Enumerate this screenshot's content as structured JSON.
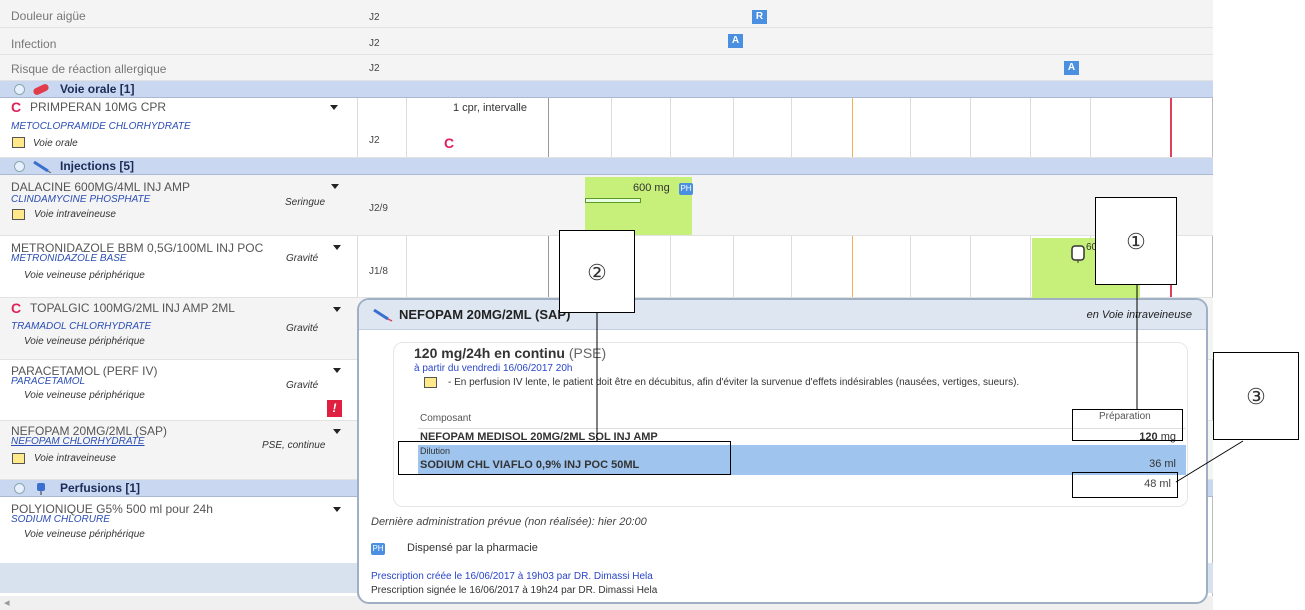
{
  "rows": {
    "douleur": {
      "label": "Douleur aigüe",
      "j": "J2",
      "marker": "R"
    },
    "infection": {
      "label": "Infection",
      "j": "J2",
      "marker": "A"
    },
    "risque": {
      "label": "Risque de réaction allergique",
      "j": "J2",
      "marker": "A"
    }
  },
  "sections": {
    "orale": "Voie orale [1]",
    "injections": "Injections [5]",
    "perfusions": "Perfusions [1]"
  },
  "drugs": [
    {
      "name": "PRIMPERAN 10MG CPR",
      "sub": "METOCLOPRAMIDE CHLORHYDRATE",
      "route": "Voie orale",
      "dose": "",
      "j": "J2",
      "info": "1 cpr, intervalle",
      "cmark": "C"
    },
    {
      "name": "DALACINE 600MG/4ML INJ AMP",
      "sub": "CLINDAMYCINE PHOSPHATE",
      "route": "Voie intraveineuse",
      "dose": "Seringue",
      "j": "J2/9",
      "info": "600 mg",
      "badge": "PH"
    },
    {
      "name": "METRONIDAZOLE BBM 0,5G/100ML INJ POC",
      "sub": "METRONIDAZOLE BASE",
      "route": "Voie veineuse périphérique",
      "dose": "Gravité",
      "j": "J1/8"
    },
    {
      "name": "TOPALGIC 100MG/2ML INJ AMP 2ML",
      "sub": "TRAMADOL CHLORHYDRATE",
      "route": "Voie veineuse périphérique",
      "dose": "Gravité"
    },
    {
      "name": "PARACETAMOL (PERF IV)",
      "sub": "PARACETAMOL",
      "route": "Voie veineuse périphérique",
      "dose": "Gravité",
      "alert": "!"
    },
    {
      "name": "NEFOPAM 20MG/2ML  (SAP)",
      "sub": "NEFOPAM CHLORHYDRATE",
      "route": "Voie intraveineuse",
      "dose": "PSE, continue"
    },
    {
      "name": "POLYIONIQUE G5% 500 ml pour 24h",
      "sub": "SODIUM CHLORURE",
      "route": "Voie veineuse périphérique",
      "dose": ""
    }
  ],
  "popup": {
    "title": "NEFOPAM 20MG/2ML (SAP)",
    "route": "en Voie intraveineuse",
    "dosage": "120 mg/24h en continu",
    "dosage_mode": "(PSE)",
    "start": "à partir du vendredi 16/06/2017 20h",
    "note": "- En perfusion IV lente, le patient doit être en décubitus, afin d'éviter la survenue d'effets indésirables (nausées, vertiges, sueurs).",
    "composant_header": "Composant",
    "preparation_header": "Préparation",
    "composant_name": "NEFOPAM MEDISOL 20MG/2ML SOL INJ AMP",
    "composant_qty_num": "120",
    "composant_qty_unit": "mg",
    "dilution_header": "Dilution",
    "dilution_name": "SODIUM CHL VIAFLO 0,9% INJ POC 50ML",
    "dilution_qty": "36 ml",
    "total_qty": "48 ml",
    "last_admin": "Dernière administration prévue (non réalisée): hier 20:00",
    "ph_badge": "PH",
    "dispensed": "Dispensé par la pharmacie",
    "created": "Prescription créée le 16/06/2017 à 19h03 par DR. Dimassi Hela",
    "signed": "Prescription signée le 16/06/2017 à 19h24 par DR. Dimassi Hela"
  },
  "callouts": {
    "one": "①",
    "two": "②",
    "three": "③"
  },
  "misc": {
    "scroll_left": "◂",
    "partial_chart_text": "60"
  }
}
